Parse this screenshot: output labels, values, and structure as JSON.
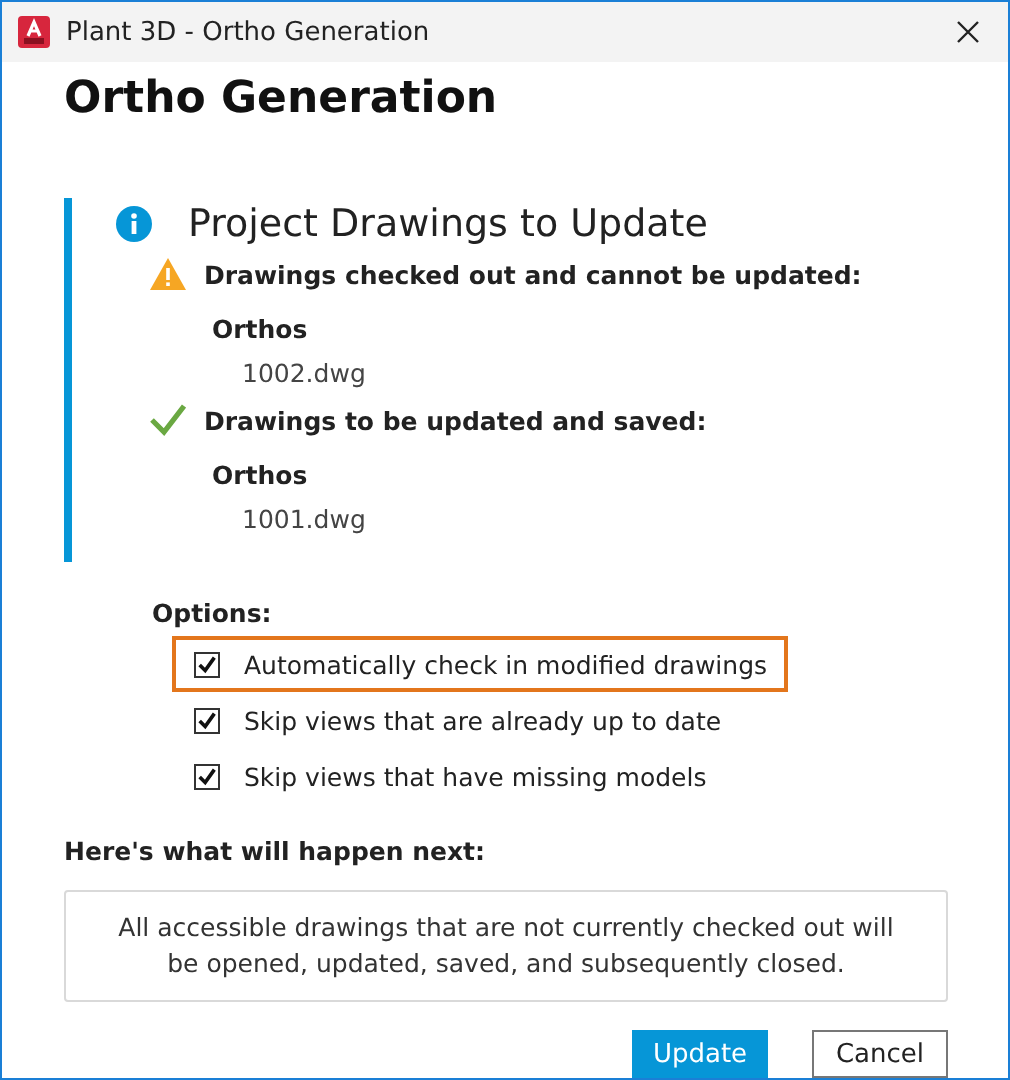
{
  "window": {
    "title": "Plant 3D - Ortho Generation"
  },
  "heading": "Ortho Generation",
  "panel": {
    "title": "Project Drawings to Update",
    "groups": [
      {
        "kind": "warning",
        "label": "Drawings checked out and cannot be updated:",
        "folder": "Orthos",
        "files": [
          "1002.dwg"
        ]
      },
      {
        "kind": "success",
        "label": "Drawings to be updated and saved:",
        "folder": "Orthos",
        "files": [
          "1001.dwg"
        ]
      }
    ]
  },
  "options": {
    "label": "Options:",
    "items": [
      {
        "label": "Automatically check in modified drawings",
        "checked": true,
        "highlighted": true
      },
      {
        "label": "Skip views that are already up to date",
        "checked": true,
        "highlighted": false
      },
      {
        "label": "Skip views that have missing models",
        "checked": true,
        "highlighted": false
      }
    ]
  },
  "next": {
    "label": "Here's what will happen next:",
    "message": "All accessible drawings that are not currently checked out will be opened, updated, saved, and subsequently closed."
  },
  "buttons": [
    {
      "label": "Update",
      "kind": "primary"
    },
    {
      "label": "Cancel",
      "kind": "secondary"
    }
  ]
}
